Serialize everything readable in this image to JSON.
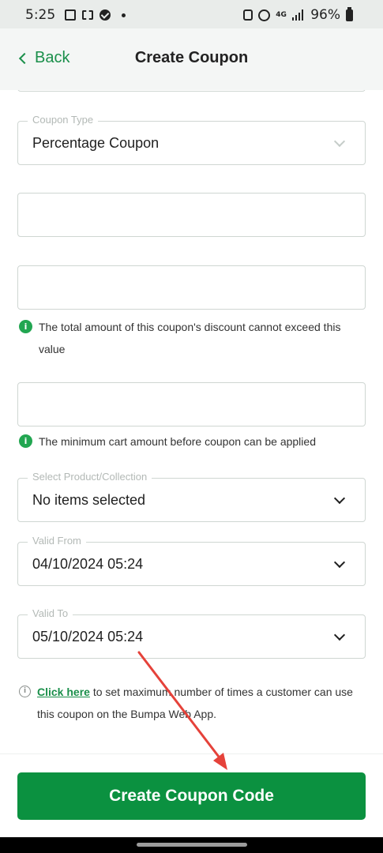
{
  "status_bar": {
    "time": "5:25",
    "battery": "96%",
    "network": "4G",
    "icons": [
      "image-icon",
      "screenshot-icon",
      "check-circle-icon",
      "dot-icon",
      "sim-icon",
      "hotspot-icon",
      "signal-icon",
      "battery-icon"
    ]
  },
  "header": {
    "back_label": "Back",
    "title": "Create Coupon"
  },
  "form": {
    "coupon_type": {
      "label": "Coupon Type",
      "value": "Percentage Coupon"
    },
    "field_2": {
      "value": ""
    },
    "field_3": {
      "value": ""
    },
    "max_discount_hint": "The total amount of this coupon's discount cannot exceed this value",
    "field_4": {
      "value": ""
    },
    "min_cart_hint": "The minimum cart amount before coupon can be applied",
    "product_collection": {
      "label": "Select Product/Collection",
      "value": "No items selected"
    },
    "valid_from": {
      "label": "Valid From",
      "value": "04/10/2024 05:24"
    },
    "valid_to": {
      "label": "Valid To",
      "value": "05/10/2024 05:24"
    },
    "usage_hint": {
      "link": "Click here",
      "text": " to set maximum number of times a customer can use this coupon on the Bumpa Web App."
    }
  },
  "footer": {
    "create_button": "Create Coupon Code"
  },
  "colors": {
    "accent": "#0b9140",
    "link": "#1a8f4a",
    "annotation_arrow": "#e5423a"
  }
}
